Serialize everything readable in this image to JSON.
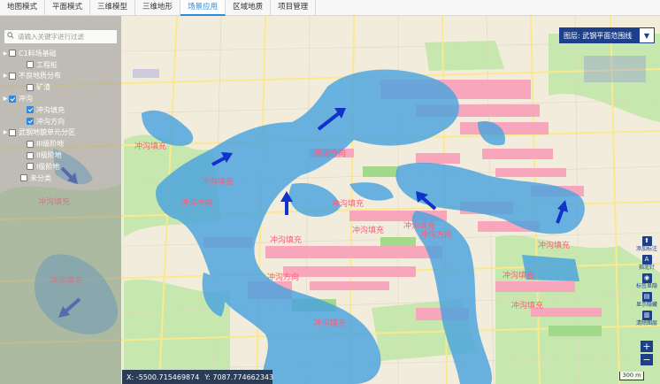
{
  "tabs": [
    {
      "label": "地图模式",
      "active": false
    },
    {
      "label": "平面模式",
      "active": false
    },
    {
      "label": "三维模型",
      "active": false
    },
    {
      "label": "三维地形",
      "active": false
    },
    {
      "label": "场景应用",
      "active": true
    },
    {
      "label": "区域地质",
      "active": false
    },
    {
      "label": "项目管理",
      "active": false
    }
  ],
  "search": {
    "placeholder": "请输入关键字进行过滤"
  },
  "layer_tree": [
    {
      "label": "C1料场基础",
      "level": 1,
      "checked": false,
      "expandable": true
    },
    {
      "label": "工程桩",
      "level": 3,
      "checked": false,
      "expandable": false
    },
    {
      "label": "不良地质分布",
      "level": 1,
      "checked": false,
      "expandable": true
    },
    {
      "label": "矿渣",
      "level": 3,
      "checked": false,
      "expandable": false
    },
    {
      "label": "冲沟",
      "level": 1,
      "checked": true,
      "expandable": true
    },
    {
      "label": "冲沟填充",
      "level": 3,
      "checked": true,
      "expandable": false
    },
    {
      "label": "冲沟方向",
      "level": 3,
      "checked": true,
      "expandable": false
    },
    {
      "label": "武钢地貌单元分区",
      "level": 1,
      "checked": false,
      "expandable": true
    },
    {
      "label": "III级阶地",
      "level": 3,
      "checked": false,
      "expandable": false
    },
    {
      "label": "II级阶地",
      "level": 3,
      "checked": false,
      "expandable": false
    },
    {
      "label": "I级阶地",
      "level": 3,
      "checked": false,
      "expandable": false
    },
    {
      "label": "未分类",
      "level": 2,
      "checked": false,
      "expandable": false
    }
  ],
  "layer_select": {
    "prefix": "图层:",
    "value": "武钢平面范围线",
    "caret_icon": "chevron-down-icon"
  },
  "tools": [
    {
      "label": "添加标注",
      "icon": "pin-icon",
      "glyph": "⬆"
    },
    {
      "label": "指北针",
      "icon": "north-arrow-icon",
      "glyph": "A"
    },
    {
      "label": "标签显隐",
      "icon": "eye-icon",
      "glyph": "◉"
    },
    {
      "label": "显示隐藏",
      "icon": "layers-icon",
      "glyph": "▤"
    },
    {
      "label": "清除图层",
      "icon": "trash-icon",
      "glyph": "▥"
    }
  ],
  "zoom": {
    "in": "+",
    "out": "−"
  },
  "coords": {
    "x": "X: -5500.715469874",
    "y": "Y: 7087.774662343"
  },
  "scale": {
    "label": "300 m"
  },
  "map_labels": [
    {
      "text": "冲沟填充"
    },
    {
      "text": "冲沟方向"
    },
    {
      "text": "冲沟填充"
    },
    {
      "text": "冲沟方向"
    },
    {
      "text": "冲沟填充"
    },
    {
      "text": "冲沟填充"
    },
    {
      "text": "冲沟填充"
    },
    {
      "text": "冲沟方向"
    },
    {
      "text": "冲沟方向"
    },
    {
      "text": "冲沟填充"
    },
    {
      "text": "冲沟填充"
    },
    {
      "text": "冲沟填充"
    },
    {
      "text": "冲沟填充"
    },
    {
      "text": "冲沟填充"
    },
    {
      "text": "冲沟填充"
    },
    {
      "text": "冲沟填充"
    }
  ],
  "colors": {
    "gully_fill": "#4aa3df",
    "arrow": "#1033c9",
    "building": "#f7a6bb",
    "green": "#bfe5a4",
    "road": "#fff6b8",
    "accent": "#2b8be0",
    "tool": "#1e3f8a"
  }
}
